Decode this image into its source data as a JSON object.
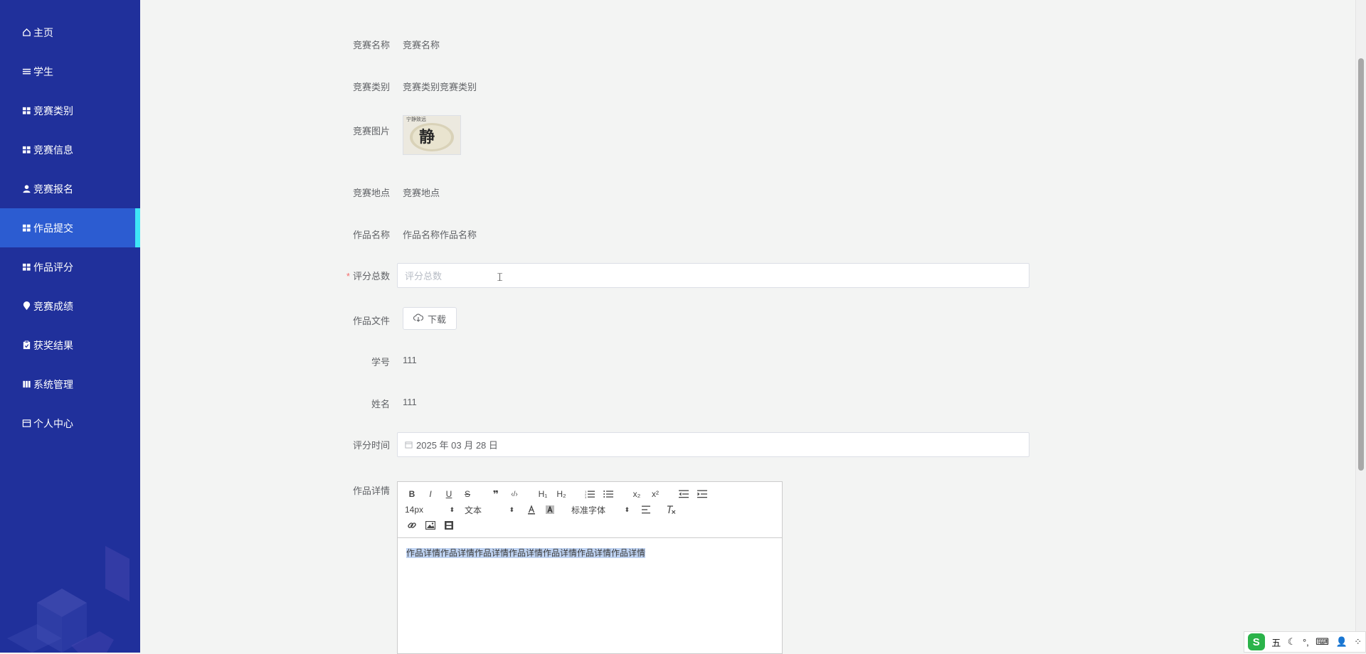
{
  "sidebar": {
    "items": [
      {
        "label": "主页",
        "icon": "home-icon"
      },
      {
        "label": "学生",
        "icon": "list-icon"
      },
      {
        "label": "竞赛类别",
        "icon": "grid-icon"
      },
      {
        "label": "竞赛信息",
        "icon": "grid-icon"
      },
      {
        "label": "竞赛报名",
        "icon": "user-icon"
      },
      {
        "label": "作品提交",
        "icon": "grid-icon",
        "active": true
      },
      {
        "label": "作品评分",
        "icon": "grid-icon"
      },
      {
        "label": "竞赛成绩",
        "icon": "location-icon"
      },
      {
        "label": "获奖结果",
        "icon": "clipboard-icon"
      },
      {
        "label": "系统管理",
        "icon": "book-icon"
      },
      {
        "label": "个人中心",
        "icon": "profile-icon"
      }
    ],
    "accent": "#3ee6f7",
    "background": "#20309b",
    "active_background": "#2c5cd1"
  },
  "form": {
    "contest_name": {
      "label": "竞赛名称",
      "value": "竞赛名称"
    },
    "contest_category": {
      "label": "竞赛类别",
      "value": "竞赛类别竞赛类别"
    },
    "contest_image": {
      "label": "竞赛图片",
      "caption": "宁静致远",
      "glyph": "静"
    },
    "contest_location": {
      "label": "竞赛地点",
      "value": "竞赛地点"
    },
    "work_name": {
      "label": "作品名称",
      "value": "作品名称作品名称"
    },
    "score_total": {
      "label": "评分总数",
      "placeholder": "评分总数",
      "required": true
    },
    "work_file": {
      "label": "作品文件",
      "button": "下载"
    },
    "student_id": {
      "label": "学号",
      "value": "111"
    },
    "student_name": {
      "label": "姓名",
      "value": "111"
    },
    "score_time": {
      "label": "评分时间",
      "value": "2025 年 03 月 28 日"
    },
    "work_detail": {
      "label": "作品详情",
      "toolbar": {
        "row1": [
          "B",
          "I",
          "U",
          "S",
          "❞",
          "‹/›",
          "H₁",
          "H₂",
          "ol",
          "ul",
          "x₂",
          "x²",
          "outdent",
          "indent"
        ],
        "font_size": "14px",
        "format": "文本",
        "font_family": "标准字体"
      },
      "content": "作品详情作品详情作品详情作品详情作品详情作品详情作品详情"
    }
  },
  "ime": {
    "logo": "S",
    "mode": "五",
    "items": [
      "☾",
      "°,",
      "⌨",
      "👤",
      "⁘"
    ]
  }
}
